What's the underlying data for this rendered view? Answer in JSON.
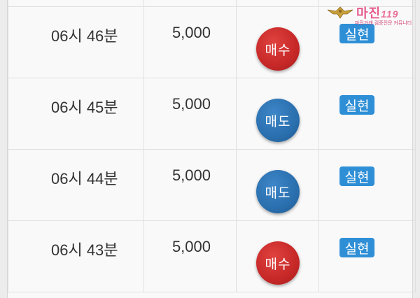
{
  "rows": [
    {
      "time": "06시 46분",
      "amount": "5,000",
      "action": "매수",
      "action_type": "buy",
      "result": "실현"
    },
    {
      "time": "06시 45분",
      "amount": "5,000",
      "action": "매도",
      "action_type": "sell",
      "result": "실현"
    },
    {
      "time": "06시 44분",
      "amount": "5,000",
      "action": "매도",
      "action_type": "sell",
      "result": "실현"
    },
    {
      "time": "06시 43분",
      "amount": "5,000",
      "action": "매수",
      "action_type": "buy",
      "result": "실현"
    }
  ],
  "watermark": {
    "logo_text": "마진",
    "logo_suffix": "119",
    "tagline": "마진거래 검증전문 커뮤니티"
  },
  "colors": {
    "buy": "#c62828",
    "sell": "#2a6fae",
    "badge": "#2e8fd6"
  }
}
